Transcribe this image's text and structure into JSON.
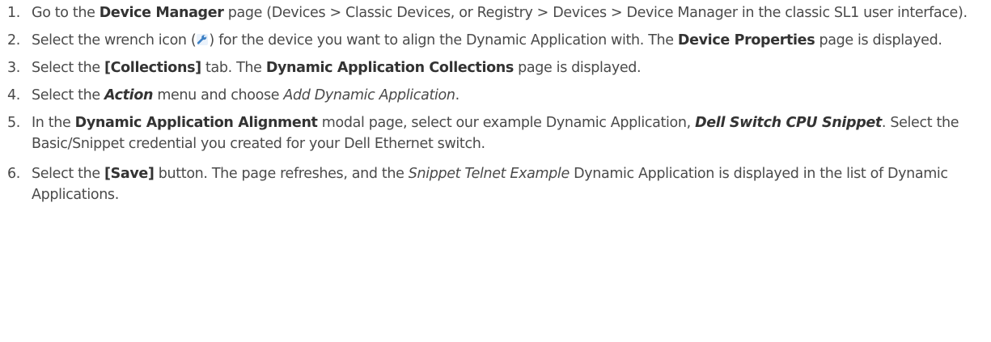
{
  "steps": [
    {
      "num": "1.",
      "t1": "Go to the ",
      "b1": "Device Manager",
      "t2": " page (Devices > Classic Devices, or Registry > Devices > Device Manager in the classic SL1 user interface)."
    },
    {
      "num": "2.",
      "t1": "Select the wrench icon (",
      "t2": ") for the device you want to align the Dynamic Application with. The ",
      "b1": "Device Properties",
      "t3": " page is displayed."
    },
    {
      "num": "3.",
      "t1": "Select the ",
      "b1": "[Collections]",
      "t2": " tab. The ",
      "b2": "Dynamic Application Collections",
      "t3": " page is displayed."
    },
    {
      "num": "4.",
      "t1": "Select the ",
      "bi1": "Action",
      "t2": " menu and choose ",
      "i1": "Add Dynamic Application",
      "t3": "."
    },
    {
      "num": "5.",
      "t1": "In the ",
      "b1": "Dynamic Application Alignment",
      "t2": " modal page, select our example Dynamic Application, ",
      "bi1": "Dell Switch CPU Snippet",
      "t3": ". Select the Basic/Snippet credential you created for your Dell Ethernet switch."
    },
    {
      "num": "6.",
      "t1": "Select the ",
      "b1": "[Save]",
      "t2": " button. The page refreshes, and the ",
      "i1": "Snippet Telnet Example ",
      "t3": " Dynamic Application is displayed in the list of Dynamic Applications."
    }
  ],
  "icons": {
    "wrench": "wrench-icon",
    "wrench_color": "#3b7fc4"
  }
}
